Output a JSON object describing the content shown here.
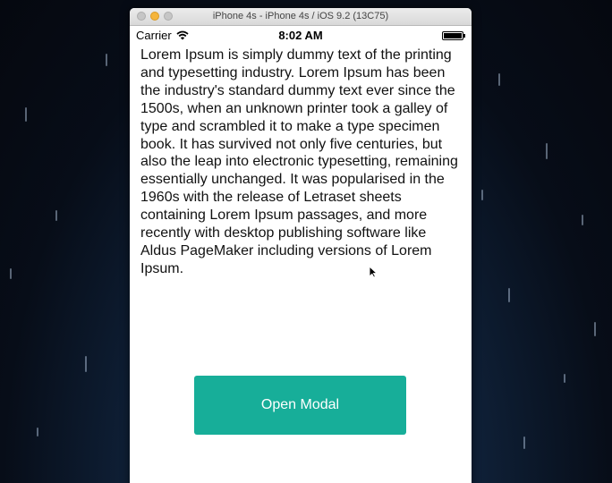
{
  "window": {
    "title": "iPhone 4s - iPhone 4s / iOS 9.2 (13C75)"
  },
  "statusbar": {
    "carrier": "Carrier",
    "time": "8:02 AM",
    "wifi_icon": "wifi-icon",
    "battery_icon": "battery-icon"
  },
  "main": {
    "body_text": "Lorem Ipsum is simply dummy text of the printing and typesetting industry. Lorem Ipsum has been the industry's standard dummy text ever since the 1500s, when an unknown printer took a galley of type and scrambled it to make a type specimen book. It has survived not only five centuries, but also the leap into electronic typesetting, remaining essentially unchanged. It was popularised in the 1960s with the release of Letraset sheets containing Lorem Ipsum passages, and more recently with desktop publishing software like Aldus PageMaker including versions of Lorem Ipsum.",
    "button_label": "Open Modal"
  },
  "colors": {
    "button_background": "#17ae99",
    "button_text": "#ffffff",
    "body_text": "#111111"
  }
}
